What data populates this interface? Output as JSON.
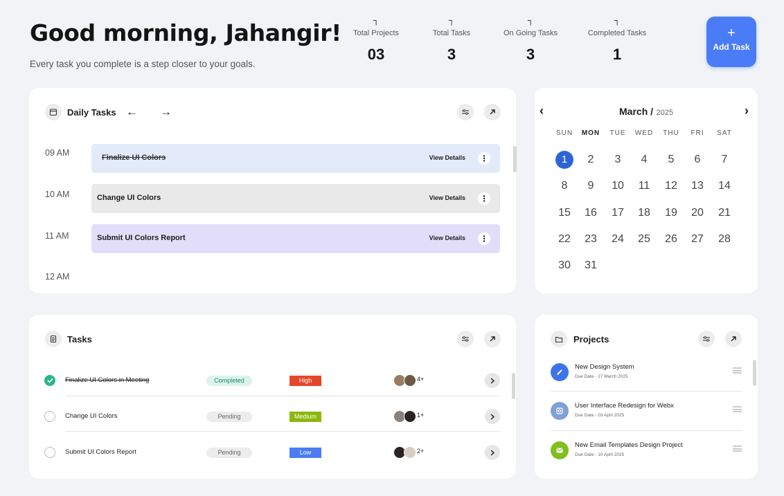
{
  "header": {
    "greeting": "Good morning, Jahangir!",
    "subtitle": "Every task you complete is a step closer to your goals."
  },
  "stats": [
    {
      "label": "Total Projects",
      "value": "03"
    },
    {
      "label": "Total Tasks",
      "value": "3"
    },
    {
      "label": "On Going Tasks",
      "value": "3"
    },
    {
      "label": "Completed Tasks",
      "value": "1"
    }
  ],
  "add_task": {
    "icon": "plus-icon",
    "label": "Add Task"
  },
  "daily_tasks": {
    "title": "Daily Tasks",
    "times": [
      "09 AM",
      "10 AM",
      "11 AM",
      "12 AM"
    ],
    "slots": [
      {
        "name": "Finalize UI Colors",
        "action": "View Details",
        "color": "#e3ebfb",
        "done": true
      },
      {
        "name": "Change UI Colors",
        "action": "View Details",
        "color": "#e9e9e9",
        "done": false
      },
      {
        "name": "Submit UI Colors Report",
        "action": "View Details",
        "color": "#e2defa",
        "done": false
      }
    ]
  },
  "calendar": {
    "month": "March /",
    "year": "2025",
    "weekdays": [
      "SUN",
      "MON",
      "TUE",
      "WED",
      "THU",
      "FRI",
      "SAT"
    ],
    "days": [
      "1",
      "2",
      "3",
      "4",
      "5",
      "6",
      "7",
      "8",
      "9",
      "10",
      "11",
      "12",
      "13",
      "14",
      "15",
      "16",
      "17",
      "18",
      "19",
      "20",
      "21",
      "22",
      "23",
      "24",
      "25",
      "26",
      "27",
      "28",
      "30",
      "31"
    ],
    "selected_day": "1",
    "accent": "#2f64d6"
  },
  "tasks": {
    "title": "Tasks",
    "rows": [
      {
        "name": "Finalize UI Colors in Meeting",
        "status": "Completed",
        "priority": "High",
        "priority_color": "#e5462a",
        "extra": "4+",
        "done": true
      },
      {
        "name": "Change UI Colors",
        "status": "Pending",
        "priority": "Medium",
        "priority_color": "#8cb80e",
        "extra": "1+",
        "done": false
      },
      {
        "name": "Submit UI Colors Report",
        "status": "Pending",
        "priority": "Low",
        "priority_color": "#4b7cf2",
        "extra": "2+",
        "done": false
      }
    ]
  },
  "projects": {
    "title": "Projects",
    "items": [
      {
        "name": "New Design System",
        "due": "Due Date - 27 March 2025",
        "icon": "pen-icon",
        "color": "#3f73ea"
      },
      {
        "name": "User Interface Redesign for Webx",
        "due": "Due Date - 03 April 2025",
        "icon": "search-icon",
        "color": "#7fa1d4"
      },
      {
        "name": "New Email Templates Design Project",
        "due": "Due Date - 10 April 2025",
        "icon": "mail-icon",
        "color": "#7fbf1f"
      }
    ]
  }
}
